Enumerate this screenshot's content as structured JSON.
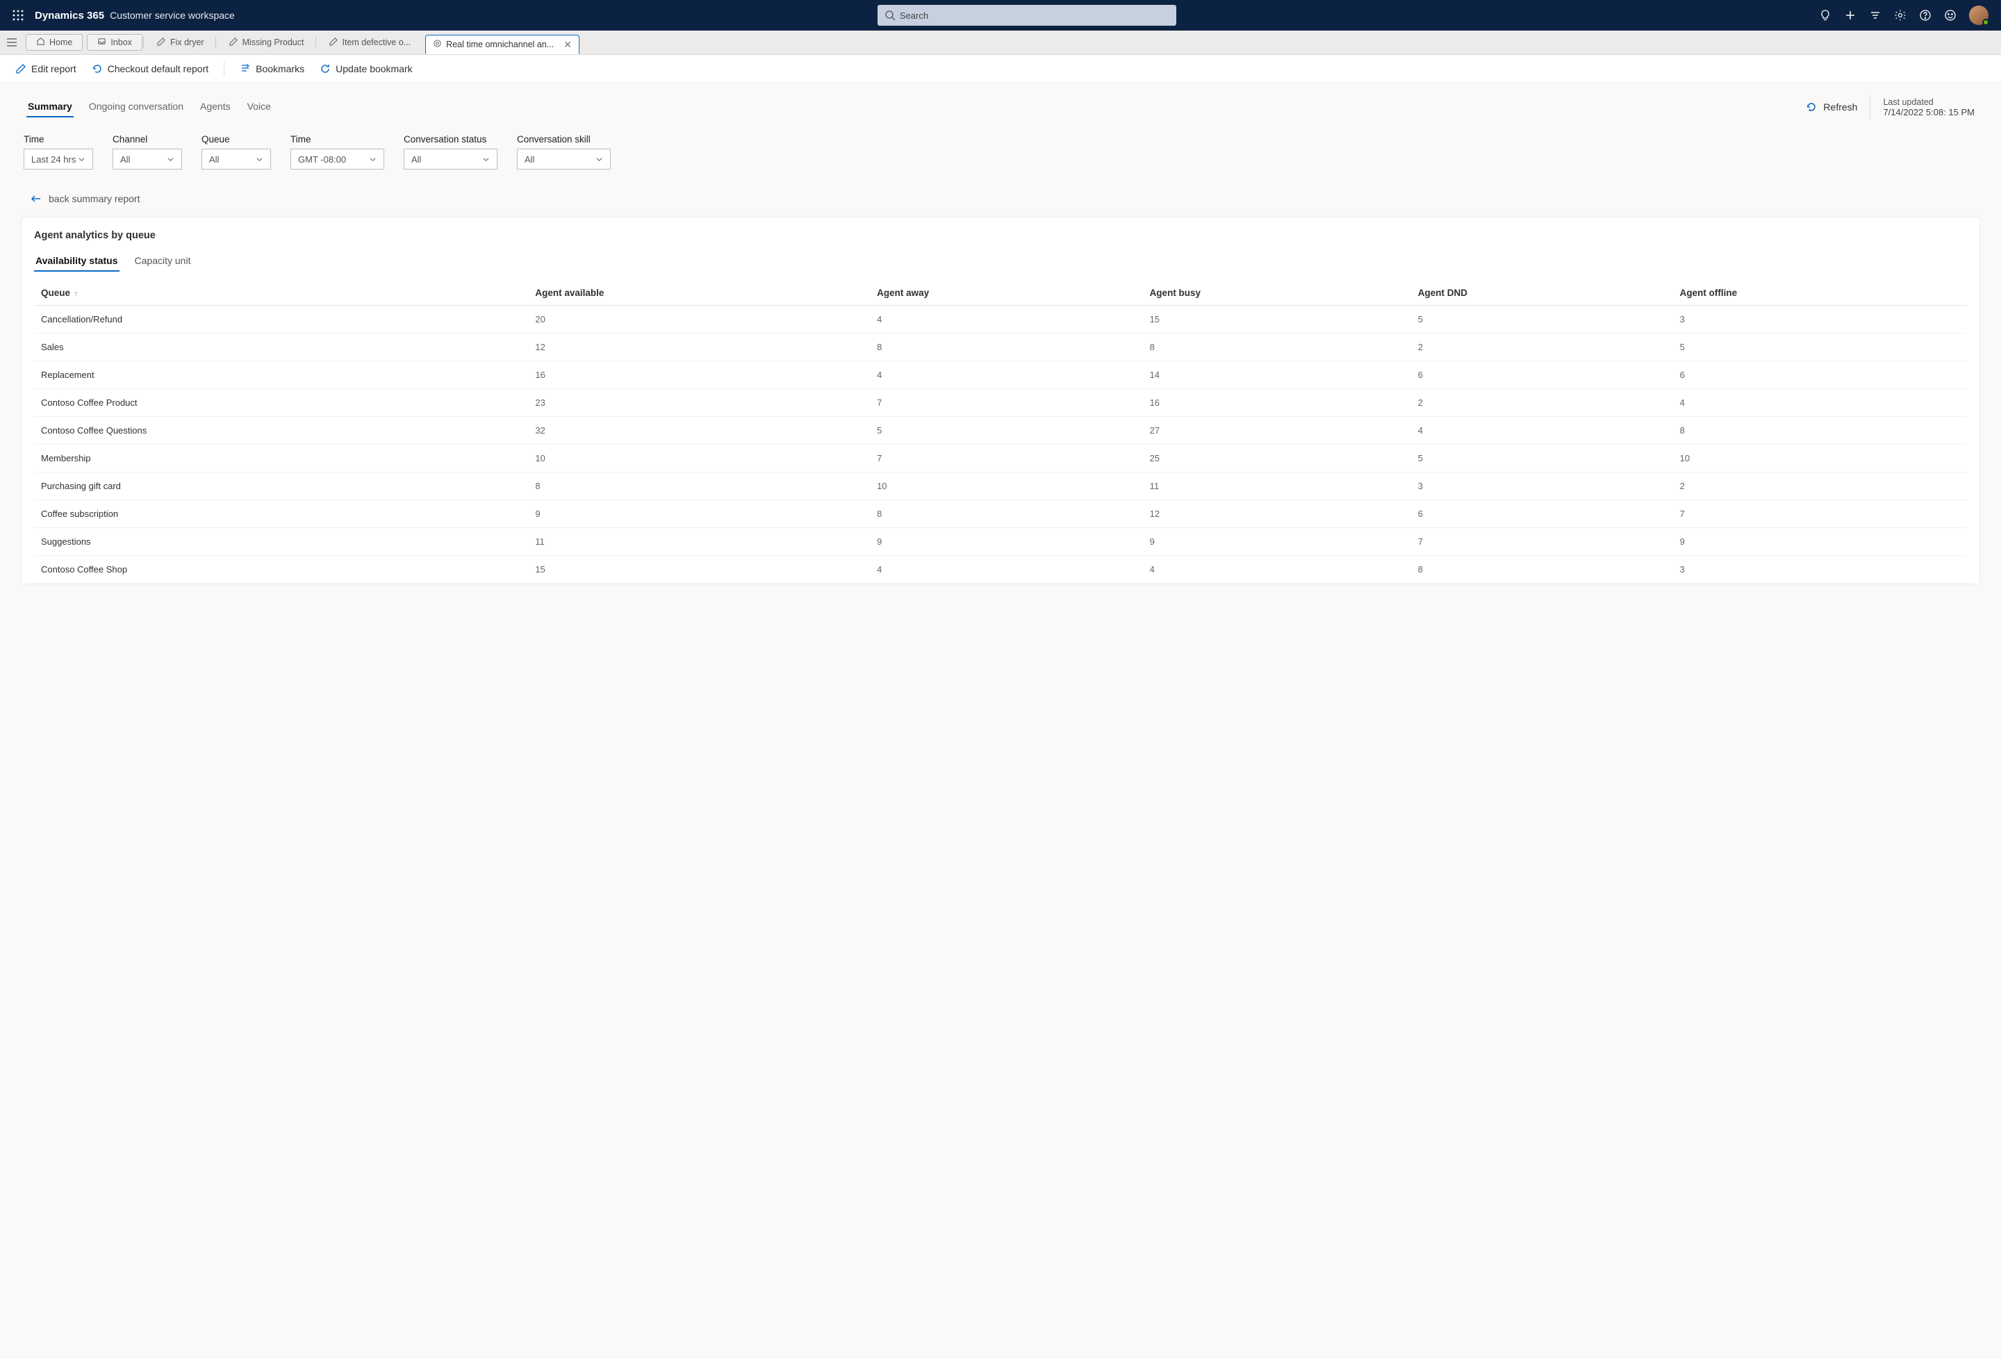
{
  "header": {
    "app_title": "Dynamics 365",
    "app_subtitle": "Customer service workspace",
    "search_placeholder": "Search"
  },
  "tabs": [
    {
      "label": "Home",
      "icon": "home",
      "boxed": true
    },
    {
      "label": "Inbox",
      "icon": "inbox",
      "boxed": true
    },
    {
      "label": "Fix dryer",
      "icon": "edit"
    },
    {
      "label": "Missing Product",
      "icon": "edit"
    },
    {
      "label": "Item defective o...",
      "icon": "edit"
    },
    {
      "label": "Real time omnichannel an...",
      "icon": "target",
      "active": true,
      "closeable": true
    }
  ],
  "toolbar": {
    "edit_report": "Edit report",
    "checkout": "Checkout default report",
    "bookmarks": "Bookmarks",
    "update_bookmark": "Update bookmark"
  },
  "main_tabs": [
    "Summary",
    "Ongoing conversation",
    "Agents",
    "Voice"
  ],
  "main_tab_active": 0,
  "refresh_label": "Refresh",
  "last_updated": {
    "label": "Last updated",
    "value": "7/14/2022 5:08: 15 PM"
  },
  "filters": [
    {
      "label": "Time",
      "value": "Last 24 hrs"
    },
    {
      "label": "Channel",
      "value": "All"
    },
    {
      "label": "Queue",
      "value": "All"
    },
    {
      "label": "Time",
      "value": "GMT -08:00",
      "wide": true
    },
    {
      "label": "Conversation status",
      "value": "All",
      "wide": true
    },
    {
      "label": "Conversation skill",
      "value": "All",
      "wide": true
    }
  ],
  "back_label": "back summary report",
  "card": {
    "title": "Agent analytics by queue",
    "sub_tabs": [
      "Availability status",
      "Capacity unit"
    ],
    "sub_tab_active": 0,
    "columns": [
      "Queue",
      "Agent available",
      "Agent away",
      "Agent busy",
      "Agent DND",
      "Agent offline"
    ],
    "rows": [
      {
        "queue": "Cancellation/Refund",
        "v": [
          20,
          4,
          15,
          5,
          3
        ]
      },
      {
        "queue": "Sales",
        "v": [
          12,
          8,
          8,
          2,
          5
        ]
      },
      {
        "queue": "Replacement",
        "v": [
          16,
          4,
          14,
          6,
          6
        ]
      },
      {
        "queue": "Contoso Coffee Product",
        "v": [
          23,
          7,
          16,
          2,
          4
        ]
      },
      {
        "queue": "Contoso Coffee Questions",
        "v": [
          32,
          5,
          27,
          4,
          8
        ]
      },
      {
        "queue": "Membership",
        "v": [
          10,
          7,
          25,
          5,
          10
        ]
      },
      {
        "queue": "Purchasing gift card",
        "v": [
          8,
          10,
          11,
          3,
          2
        ]
      },
      {
        "queue": "Coffee subscription",
        "v": [
          9,
          8,
          12,
          6,
          7
        ]
      },
      {
        "queue": "Suggestions",
        "v": [
          11,
          9,
          9,
          7,
          9
        ]
      },
      {
        "queue": "Contoso Coffee Shop",
        "v": [
          15,
          4,
          4,
          8,
          3
        ]
      }
    ]
  }
}
